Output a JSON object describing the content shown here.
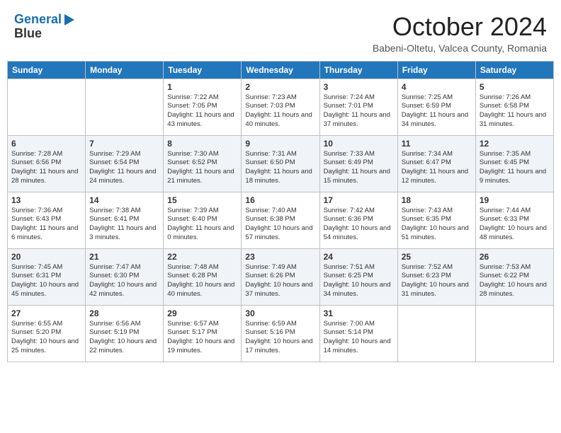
{
  "header": {
    "logo_line1": "General",
    "logo_line2": "Blue",
    "month": "October 2024",
    "location": "Babeni-Oltetu, Valcea County, Romania"
  },
  "days_of_week": [
    "Sunday",
    "Monday",
    "Tuesday",
    "Wednesday",
    "Thursday",
    "Friday",
    "Saturday"
  ],
  "weeks": [
    [
      {
        "day": "",
        "info": ""
      },
      {
        "day": "",
        "info": ""
      },
      {
        "day": "1",
        "info": "Sunrise: 7:22 AM\nSunset: 7:05 PM\nDaylight: 11 hours and 43 minutes."
      },
      {
        "day": "2",
        "info": "Sunrise: 7:23 AM\nSunset: 7:03 PM\nDaylight: 11 hours and 40 minutes."
      },
      {
        "day": "3",
        "info": "Sunrise: 7:24 AM\nSunset: 7:01 PM\nDaylight: 11 hours and 37 minutes."
      },
      {
        "day": "4",
        "info": "Sunrise: 7:25 AM\nSunset: 6:59 PM\nDaylight: 11 hours and 34 minutes."
      },
      {
        "day": "5",
        "info": "Sunrise: 7:26 AM\nSunset: 6:58 PM\nDaylight: 11 hours and 31 minutes."
      }
    ],
    [
      {
        "day": "6",
        "info": "Sunrise: 7:28 AM\nSunset: 6:56 PM\nDaylight: 11 hours and 28 minutes."
      },
      {
        "day": "7",
        "info": "Sunrise: 7:29 AM\nSunset: 6:54 PM\nDaylight: 11 hours and 24 minutes."
      },
      {
        "day": "8",
        "info": "Sunrise: 7:30 AM\nSunset: 6:52 PM\nDaylight: 11 hours and 21 minutes."
      },
      {
        "day": "9",
        "info": "Sunrise: 7:31 AM\nSunset: 6:50 PM\nDaylight: 11 hours and 18 minutes."
      },
      {
        "day": "10",
        "info": "Sunrise: 7:33 AM\nSunset: 6:49 PM\nDaylight: 11 hours and 15 minutes."
      },
      {
        "day": "11",
        "info": "Sunrise: 7:34 AM\nSunset: 6:47 PM\nDaylight: 11 hours and 12 minutes."
      },
      {
        "day": "12",
        "info": "Sunrise: 7:35 AM\nSunset: 6:45 PM\nDaylight: 11 hours and 9 minutes."
      }
    ],
    [
      {
        "day": "13",
        "info": "Sunrise: 7:36 AM\nSunset: 6:43 PM\nDaylight: 11 hours and 6 minutes."
      },
      {
        "day": "14",
        "info": "Sunrise: 7:38 AM\nSunset: 6:41 PM\nDaylight: 11 hours and 3 minutes."
      },
      {
        "day": "15",
        "info": "Sunrise: 7:39 AM\nSunset: 6:40 PM\nDaylight: 11 hours and 0 minutes."
      },
      {
        "day": "16",
        "info": "Sunrise: 7:40 AM\nSunset: 6:38 PM\nDaylight: 10 hours and 57 minutes."
      },
      {
        "day": "17",
        "info": "Sunrise: 7:42 AM\nSunset: 6:36 PM\nDaylight: 10 hours and 54 minutes."
      },
      {
        "day": "18",
        "info": "Sunrise: 7:43 AM\nSunset: 6:35 PM\nDaylight: 10 hours and 51 minutes."
      },
      {
        "day": "19",
        "info": "Sunrise: 7:44 AM\nSunset: 6:33 PM\nDaylight: 10 hours and 48 minutes."
      }
    ],
    [
      {
        "day": "20",
        "info": "Sunrise: 7:45 AM\nSunset: 6:31 PM\nDaylight: 10 hours and 45 minutes."
      },
      {
        "day": "21",
        "info": "Sunrise: 7:47 AM\nSunset: 6:30 PM\nDaylight: 10 hours and 42 minutes."
      },
      {
        "day": "22",
        "info": "Sunrise: 7:48 AM\nSunset: 6:28 PM\nDaylight: 10 hours and 40 minutes."
      },
      {
        "day": "23",
        "info": "Sunrise: 7:49 AM\nSunset: 6:26 PM\nDaylight: 10 hours and 37 minutes."
      },
      {
        "day": "24",
        "info": "Sunrise: 7:51 AM\nSunset: 6:25 PM\nDaylight: 10 hours and 34 minutes."
      },
      {
        "day": "25",
        "info": "Sunrise: 7:52 AM\nSunset: 6:23 PM\nDaylight: 10 hours and 31 minutes."
      },
      {
        "day": "26",
        "info": "Sunrise: 7:53 AM\nSunset: 6:22 PM\nDaylight: 10 hours and 28 minutes."
      }
    ],
    [
      {
        "day": "27",
        "info": "Sunrise: 6:55 AM\nSunset: 5:20 PM\nDaylight: 10 hours and 25 minutes."
      },
      {
        "day": "28",
        "info": "Sunrise: 6:56 AM\nSunset: 5:19 PM\nDaylight: 10 hours and 22 minutes."
      },
      {
        "day": "29",
        "info": "Sunrise: 6:57 AM\nSunset: 5:17 PM\nDaylight: 10 hours and 19 minutes."
      },
      {
        "day": "30",
        "info": "Sunrise: 6:59 AM\nSunset: 5:16 PM\nDaylight: 10 hours and 17 minutes."
      },
      {
        "day": "31",
        "info": "Sunrise: 7:00 AM\nSunset: 5:14 PM\nDaylight: 10 hours and 14 minutes."
      },
      {
        "day": "",
        "info": ""
      },
      {
        "day": "",
        "info": ""
      }
    ]
  ]
}
